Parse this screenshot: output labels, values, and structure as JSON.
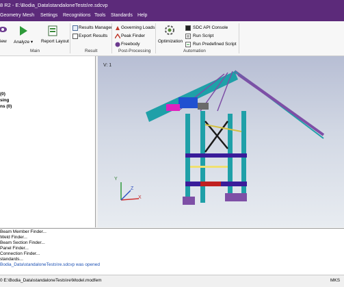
{
  "window": {
    "title": "8 R2 - E:\\Bodia_Data\\standaloneTests\\re.sdcvp"
  },
  "menu": [
    "Geometry",
    "Mesh",
    "Settings",
    "Recognitions",
    "Tools",
    "Standards",
    "Help"
  ],
  "ribbon": {
    "main": {
      "view": "iew",
      "analyze": "Analyze",
      "report_layout": "Report Layout",
      "group": "Main"
    },
    "result": {
      "results_manager": "Results Manager",
      "export_results": "Export Results",
      "group": "Result"
    },
    "postprocessing": {
      "governing_loads": "Governing Loads",
      "peak_finder": "Peak Finder",
      "freebody": "Freebody",
      "group": "Post-Processing"
    },
    "automation": {
      "optimization": "Optimization",
      "sdc_api_console": "SDC API Console",
      "run_script": "Run Script",
      "run_predefined_script": "Run Predefined Script",
      "group": "Automation"
    }
  },
  "tree": [
    "(0)",
    "sing",
    "ns (0)"
  ],
  "viewport": {
    "label": "V: 1",
    "axis_x": "X",
    "axis_y": "Y",
    "axis_z": "Z"
  },
  "log": [
    "Beam Member Finder...",
    "Weld Finder...",
    "Beam Section Finder...",
    "Panel Finder...",
    "Connection Finder...",
    "standards...",
    "Bodia_Data\\standaloneTests\\re.sdcvp was opened"
  ],
  "status": {
    "path": "0  E:\\Bodia_Data\\standaloneTests\\re\\Model.modfem",
    "right": "MKS"
  },
  "colors": {
    "titlebar": "#5c2a7a",
    "log_link": "#1a4fb3"
  }
}
